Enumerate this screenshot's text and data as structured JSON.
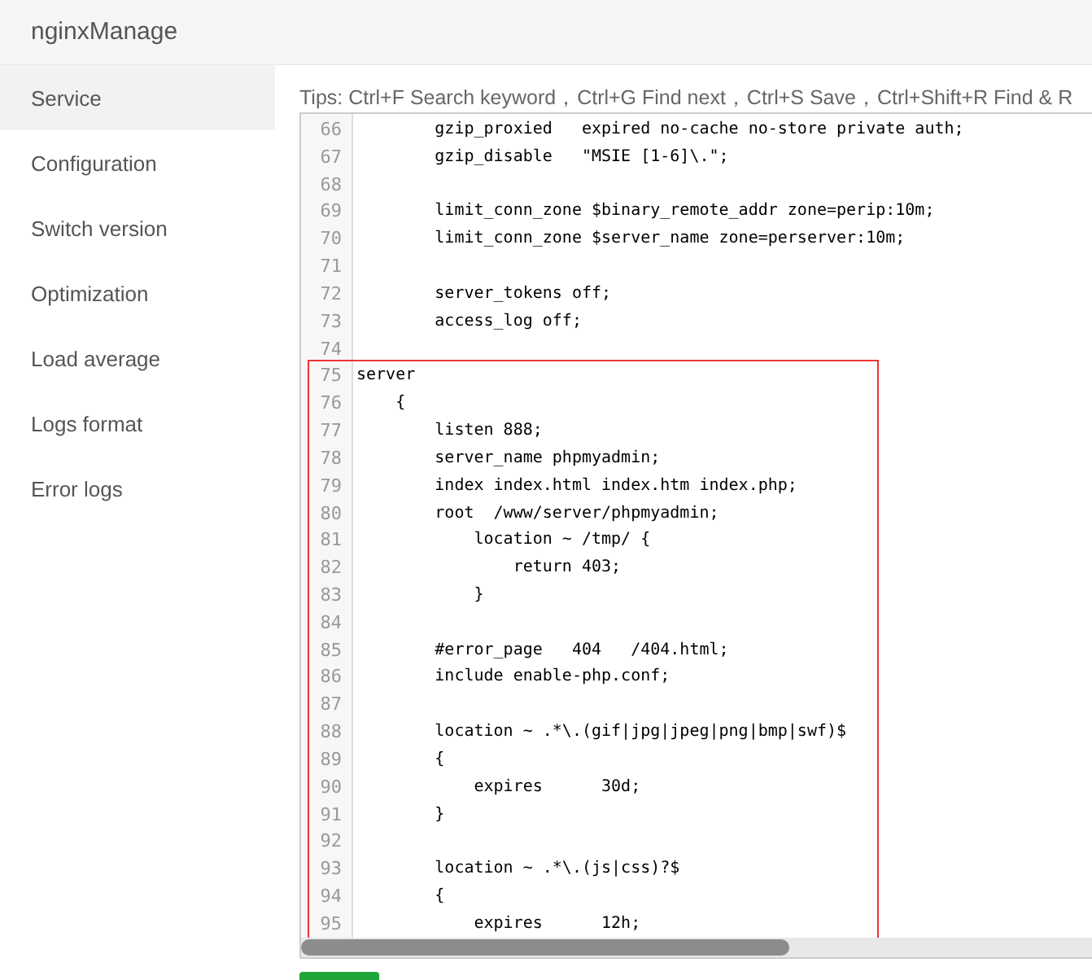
{
  "app": {
    "title": "nginxManage"
  },
  "sidebar": {
    "items": [
      {
        "label": "Service",
        "selected": true
      },
      {
        "label": "Configuration",
        "selected": false
      },
      {
        "label": "Switch version",
        "selected": false
      },
      {
        "label": "Optimization",
        "selected": false
      },
      {
        "label": "Load average",
        "selected": false
      },
      {
        "label": "Logs format",
        "selected": false
      },
      {
        "label": "Error logs",
        "selected": false
      }
    ]
  },
  "tips": "Tips:  Ctrl+F Search keyword，Ctrl+G Find next，Ctrl+S Save，Ctrl+Shift+R Find & R",
  "editor": {
    "lines": [
      {
        "number": "66",
        "text": "        gzip_proxied   expired no-cache no-store private auth;"
      },
      {
        "number": "67",
        "text": "        gzip_disable   \"MSIE [1-6]\\.\";"
      },
      {
        "number": "68"
      },
      {
        "number": "69",
        "text": "        limit_conn_zone $binary_remote_addr zone=perip:10m;"
      },
      {
        "number": "70",
        "text": "        limit_conn_zone $server_name zone=perserver:10m;"
      },
      {
        "number": "71"
      },
      {
        "number": "72",
        "text": "        server_tokens off;"
      },
      {
        "number": "73",
        "text": "        access_log off;"
      },
      {
        "number": "74"
      },
      {
        "number": "75",
        "text": "server"
      },
      {
        "number": "76",
        "text": "    {"
      },
      {
        "number": "77",
        "text": "        listen 888;"
      },
      {
        "number": "78",
        "text": "        server_name phpmyadmin;"
      },
      {
        "number": "79",
        "text": "        index index.html index.htm index.php;"
      },
      {
        "number": "80",
        "text": "        root  /www/server/phpmyadmin;"
      },
      {
        "number": "81",
        "text": "            location ~ /tmp/ {"
      },
      {
        "number": "82",
        "text": "                return 403;"
      },
      {
        "number": "83",
        "text": "            }"
      },
      {
        "number": "84"
      },
      {
        "number": "85",
        "text": "        #error_page   404   /404.html;"
      },
      {
        "number": "86",
        "text": "        include enable-php.conf;"
      },
      {
        "number": "87"
      },
      {
        "number": "88",
        "text": "        location ~ .*\\.(gif|jpg|jpeg|png|bmp|swf)$"
      },
      {
        "number": "89",
        "text": "        {"
      },
      {
        "number": "90",
        "text": "            expires      30d;"
      },
      {
        "number": "91",
        "text": "        }"
      },
      {
        "number": "92"
      },
      {
        "number": "93",
        "text": "        location ~ .*\\.(js|css)?$"
      },
      {
        "number": "94",
        "text": "        {"
      },
      {
        "number": "95",
        "text": "            expires      12h;"
      }
    ]
  }
}
